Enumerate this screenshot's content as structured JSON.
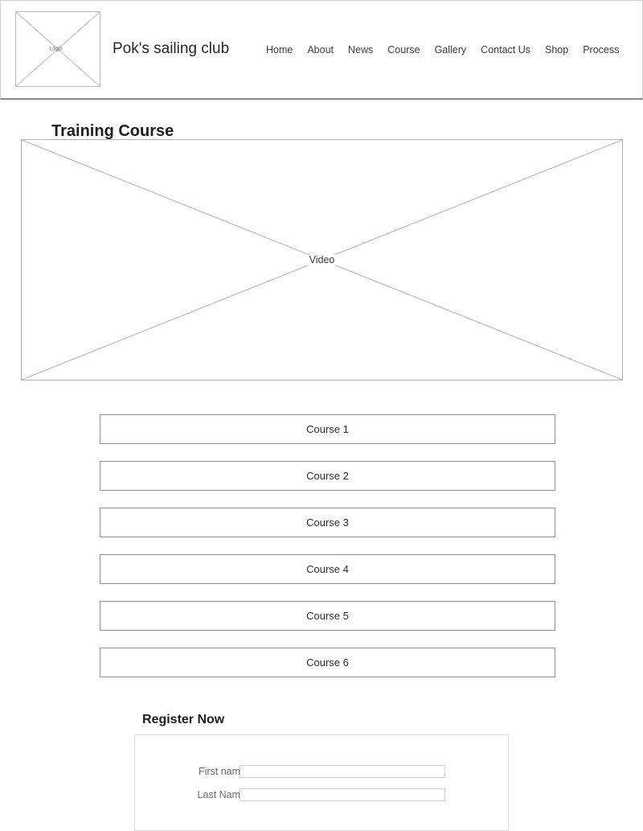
{
  "header": {
    "logo": {
      "label": "Logo",
      "icon": "image-placeholder-icon"
    },
    "brand_title": "Pok's sailing club",
    "nav": [
      {
        "label": "Home"
      },
      {
        "label": "About"
      },
      {
        "label": "News"
      },
      {
        "label": "Course"
      },
      {
        "label": "Gallery"
      },
      {
        "label": "Contact Us"
      },
      {
        "label": "Shop"
      },
      {
        "label": "Process"
      }
    ]
  },
  "main": {
    "page_title": "Training Course",
    "video": {
      "label": "Video",
      "icon": "video-placeholder-icon"
    },
    "courses": [
      {
        "label": "Course 1"
      },
      {
        "label": "Course 2"
      },
      {
        "label": "Course 3"
      },
      {
        "label": "Course 4"
      },
      {
        "label": "Course 5"
      },
      {
        "label": "Course 6"
      }
    ],
    "register": {
      "heading": "Register Now",
      "fields": [
        {
          "label": "First name",
          "value": "",
          "placeholder": ""
        },
        {
          "label": "Last Name",
          "value": "",
          "placeholder": ""
        }
      ]
    }
  },
  "colors": {
    "page_background": "#ffffff",
    "header_border": "#cfcfcf",
    "header_rule": "#8a8a8a",
    "placeholder_stroke": "#b0b0b0",
    "button_border": "#8f8f8f",
    "panel_border": "#dcdcdc",
    "input_border": "#cdcdcd",
    "text_primary": "#262626",
    "text_muted": "#6a6a6a"
  }
}
